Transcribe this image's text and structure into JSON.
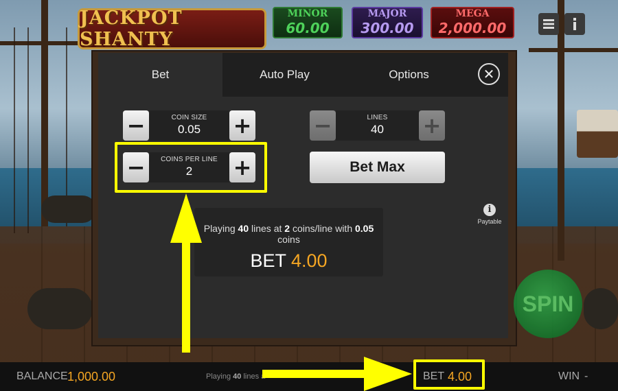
{
  "header": {
    "logo_text": "JACKPOT SHANTY",
    "jackpots": [
      {
        "label": "MINOR",
        "value": "60.00"
      },
      {
        "label": "MAJOR",
        "value": "300.00"
      },
      {
        "label": "MEGA",
        "value": "2,000.00"
      }
    ],
    "menu_icon": "hamburger-icon",
    "info_icon": "info-icon"
  },
  "modal": {
    "tabs": [
      {
        "label": "Bet",
        "active": true
      },
      {
        "label": "Auto Play",
        "active": false
      },
      {
        "label": "Options",
        "active": false
      }
    ],
    "close_symbol": "✕",
    "coin_size": {
      "caption": "COIN SIZE",
      "value": "0.05",
      "minus": "−",
      "plus": "+"
    },
    "coins_per_line": {
      "caption": "COINS PER LINE",
      "value": "2",
      "minus": "−",
      "plus": "+"
    },
    "lines": {
      "caption": "LINES",
      "value": "40",
      "minus": "−",
      "plus": "+"
    },
    "bet_max_label": "Bet Max",
    "summary": {
      "prefix": "Playing ",
      "lines": "40",
      "mid1": " lines at ",
      "coins": "2",
      "mid2": " coins/line with ",
      "coin_size": "0.05",
      "suffix": " coins",
      "bet_label": "BET",
      "bet_value": "4.00"
    },
    "paytable": {
      "icon": "i",
      "label": "Paytable"
    }
  },
  "spin_label": "SPIN",
  "footer": {
    "balance_label": "BALANCE",
    "balance_value": "1,000.00",
    "status_prefix": "Playing ",
    "status_lines": "40",
    "status_suffix": " lines a",
    "bet_label": "BET",
    "bet_value": "4.00",
    "win_label": "WIN",
    "win_value": "-"
  },
  "colors": {
    "accent_orange": "#f5a623",
    "highlight_yellow": "#ffff00",
    "minor_green": "#4ed25a",
    "major_purple": "#b69af0",
    "mega_red": "#ff6a6a"
  }
}
